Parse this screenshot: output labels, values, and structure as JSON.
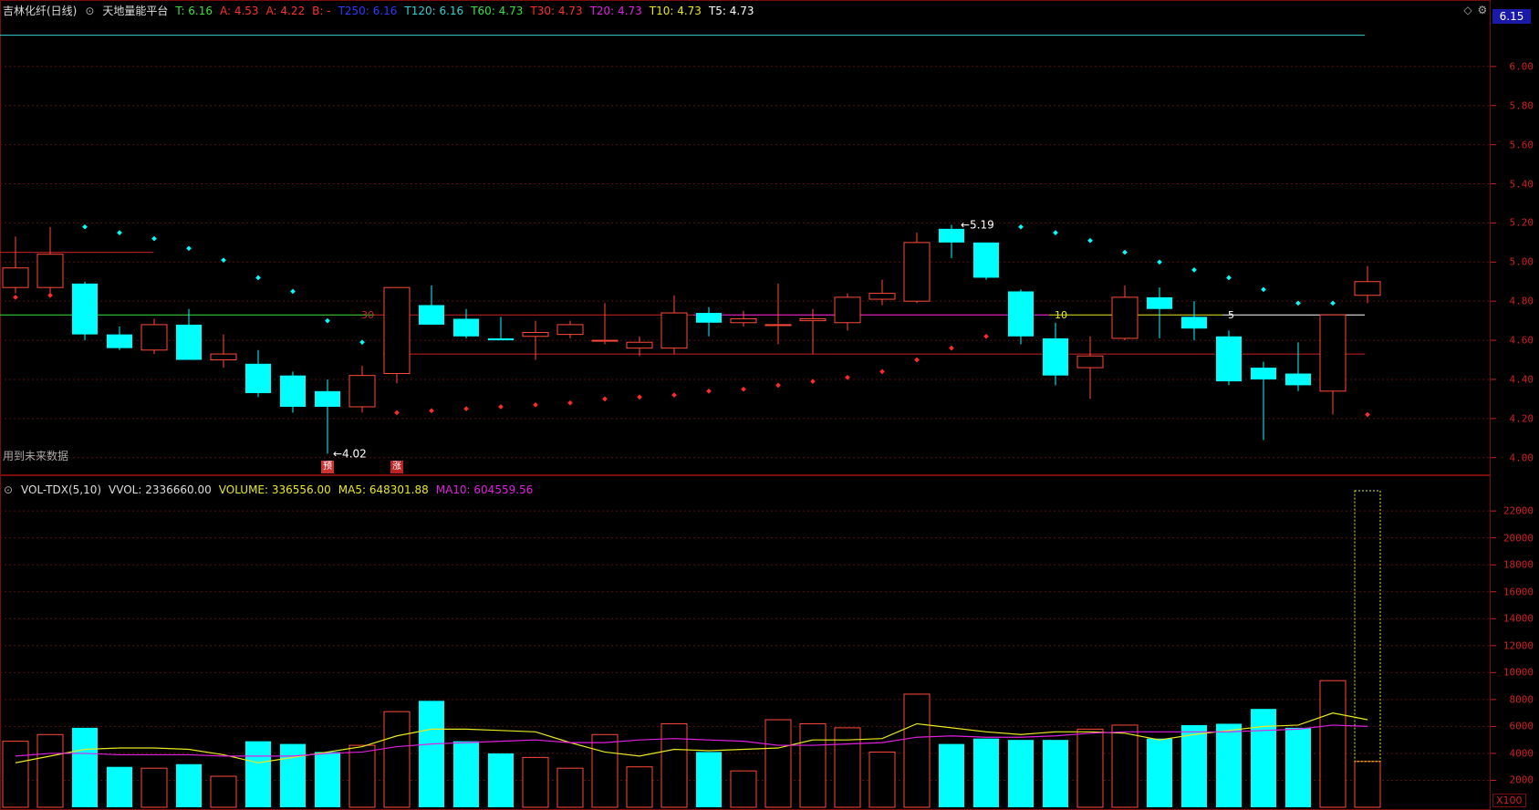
{
  "header": {
    "stock_name": "吉林化纤(日线)",
    "indicator_name": "天地量能平台",
    "items": [
      {
        "label": "T:",
        "value": "6.16",
        "color": "#3be13b"
      },
      {
        "label": "A:",
        "value": "4.53",
        "color": "#ff3030"
      },
      {
        "label": "A:",
        "value": "4.22",
        "color": "#ff3030"
      },
      {
        "label": "B:",
        "value": "-",
        "color": "#ff3030"
      },
      {
        "label": "T250:",
        "value": "6.16",
        "color": "#2a3cff"
      },
      {
        "label": "T120:",
        "value": "6.16",
        "color": "#35d0d0"
      },
      {
        "label": "T60:",
        "value": "4.73",
        "color": "#3be13b"
      },
      {
        "label": "T30:",
        "value": "4.73",
        "color": "#ff3030"
      },
      {
        "label": "T20:",
        "value": "4.73",
        "color": "#e020e0"
      },
      {
        "label": "T10:",
        "value": "4.73",
        "color": "#e8e820"
      },
      {
        "label": "T5:",
        "value": "4.73",
        "color": "#ffffff"
      }
    ]
  },
  "vol_header": {
    "indicator": "VOL-TDX(5,10)",
    "vvol": "VVOL: 2336660.00",
    "volume": "VOLUME: 336556.00",
    "ma5": "MA5: 648301.88",
    "ma10": "MA10: 604559.56"
  },
  "price_tag": "6.15",
  "future_note": "用到未来数据",
  "x100_label": "X100",
  "markers": [
    {
      "text": "预",
      "bg": "#c33",
      "ref_index": 9
    },
    {
      "text": "涨",
      "bg": "#b22",
      "ref_index": 11
    }
  ],
  "annotations": {
    "low_label": "4.02",
    "high_label": "5.19",
    "level_labels": {
      "t30": "30",
      "t10": "10",
      "t5": "5"
    }
  },
  "chart_data": {
    "type": "candlestick",
    "price_ticks": [
      "6.00",
      "5.80",
      "5.60",
      "5.40",
      "5.20",
      "5.00",
      "4.80",
      "4.60",
      "4.40",
      "4.20",
      "4.00"
    ],
    "price_range": [
      3.98,
      6.2
    ],
    "volume_ticks": [
      "22000",
      "20000",
      "18000",
      "16000",
      "14000",
      "12000",
      "10000",
      "8000",
      "6000",
      "4000",
      "2000"
    ],
    "volume_range": [
      0,
      23500
    ],
    "candles": [
      {
        "o": 4.87,
        "h": 5.13,
        "l": 4.84,
        "c": 4.97
      },
      {
        "o": 4.87,
        "h": 5.18,
        "l": 4.83,
        "c": 5.04
      },
      {
        "o": 4.89,
        "h": 4.9,
        "l": 4.6,
        "c": 4.63
      },
      {
        "o": 4.63,
        "h": 4.67,
        "l": 4.55,
        "c": 4.56
      },
      {
        "o": 4.55,
        "h": 4.71,
        "l": 4.53,
        "c": 4.68
      },
      {
        "o": 4.68,
        "h": 4.76,
        "l": 4.5,
        "c": 4.5
      },
      {
        "o": 4.5,
        "h": 4.63,
        "l": 4.46,
        "c": 4.53
      },
      {
        "o": 4.48,
        "h": 4.55,
        "l": 4.31,
        "c": 4.33
      },
      {
        "o": 4.42,
        "h": 4.44,
        "l": 4.23,
        "c": 4.26
      },
      {
        "o": 4.34,
        "h": 4.4,
        "l": 4.02,
        "c": 4.26
      },
      {
        "o": 4.26,
        "h": 4.47,
        "l": 4.23,
        "c": 4.42
      },
      {
        "o": 4.43,
        "h": 4.87,
        "l": 4.38,
        "c": 4.87
      },
      {
        "o": 4.78,
        "h": 4.88,
        "l": 4.68,
        "c": 4.68
      },
      {
        "o": 4.71,
        "h": 4.76,
        "l": 4.61,
        "c": 4.62
      },
      {
        "o": 4.61,
        "h": 4.72,
        "l": 4.6,
        "c": 4.6
      },
      {
        "o": 4.62,
        "h": 4.7,
        "l": 4.5,
        "c": 4.64
      },
      {
        "o": 4.63,
        "h": 4.7,
        "l": 4.61,
        "c": 4.68
      },
      {
        "o": 4.6,
        "h": 4.79,
        "l": 4.58,
        "c": 4.6
      },
      {
        "o": 4.56,
        "h": 4.62,
        "l": 4.52,
        "c": 4.59
      },
      {
        "o": 4.56,
        "h": 4.83,
        "l": 4.53,
        "c": 4.74
      },
      {
        "o": 4.74,
        "h": 4.77,
        "l": 4.62,
        "c": 4.69
      },
      {
        "o": 4.69,
        "h": 4.75,
        "l": 4.67,
        "c": 4.71
      },
      {
        "o": 4.68,
        "h": 4.89,
        "l": 4.58,
        "c": 4.68
      },
      {
        "o": 4.7,
        "h": 4.76,
        "l": 4.53,
        "c": 4.71
      },
      {
        "o": 4.69,
        "h": 4.84,
        "l": 4.65,
        "c": 4.82
      },
      {
        "o": 4.81,
        "h": 4.91,
        "l": 4.78,
        "c": 4.84
      },
      {
        "o": 4.8,
        "h": 5.15,
        "l": 4.79,
        "c": 5.1
      },
      {
        "o": 5.17,
        "h": 5.19,
        "l": 5.02,
        "c": 5.1
      },
      {
        "o": 5.1,
        "h": 5.1,
        "l": 4.91,
        "c": 4.92
      },
      {
        "o": 4.85,
        "h": 4.86,
        "l": 4.58,
        "c": 4.62
      },
      {
        "o": 4.61,
        "h": 4.69,
        "l": 4.37,
        "c": 4.42
      },
      {
        "o": 4.46,
        "h": 4.62,
        "l": 4.3,
        "c": 4.52
      },
      {
        "o": 4.61,
        "h": 4.88,
        "l": 4.6,
        "c": 4.82
      },
      {
        "o": 4.82,
        "h": 4.87,
        "l": 4.61,
        "c": 4.76
      },
      {
        "o": 4.72,
        "h": 4.8,
        "l": 4.6,
        "c": 4.66
      },
      {
        "o": 4.62,
        "h": 4.65,
        "l": 4.37,
        "c": 4.39
      },
      {
        "o": 4.46,
        "h": 4.49,
        "l": 4.09,
        "c": 4.4
      },
      {
        "o": 4.43,
        "h": 4.59,
        "l": 4.34,
        "c": 4.37
      },
      {
        "o": 4.34,
        "h": 4.73,
        "l": 4.22,
        "c": 4.73
      },
      {
        "o": 4.83,
        "h": 4.98,
        "l": 4.79,
        "c": 4.9
      }
    ],
    "sar_points": [
      4.82,
      4.83,
      5.18,
      5.15,
      5.12,
      5.07,
      5.01,
      4.92,
      4.85,
      4.7,
      4.59,
      4.23,
      4.24,
      4.25,
      4.26,
      4.27,
      4.28,
      4.3,
      4.31,
      4.32,
      4.34,
      4.35,
      4.37,
      4.39,
      4.41,
      4.44,
      4.5,
      4.56,
      4.62,
      5.18,
      5.15,
      5.11,
      5.05,
      5.0,
      4.96,
      4.92,
      4.86,
      4.79,
      4.79,
      4.22
    ],
    "sar_colors": [
      "red",
      "red",
      "cyan",
      "cyan",
      "cyan",
      "cyan",
      "cyan",
      "cyan",
      "cyan",
      "cyan",
      "cyan",
      "red",
      "red",
      "red",
      "red",
      "red",
      "red",
      "red",
      "red",
      "red",
      "red",
      "red",
      "red",
      "red",
      "red",
      "red",
      "red",
      "red",
      "red",
      "cyan",
      "cyan",
      "cyan",
      "cyan",
      "cyan",
      "cyan",
      "cyan",
      "cyan",
      "cyan",
      "cyan",
      "red"
    ],
    "volumes": [
      4900,
      5400,
      5900,
      3000,
      2900,
      3200,
      2300,
      4900,
      4700,
      4100,
      4600,
      7100,
      7900,
      4900,
      4000,
      3700,
      2900,
      5400,
      3000,
      6200,
      4100,
      2700,
      6500,
      6200,
      5900,
      4100,
      8400,
      4700,
      5100,
      5000,
      5000,
      5800,
      6100,
      5100,
      6100,
      6200,
      7300,
      5900,
      9400,
      3400
    ],
    "vol_ma5": [
      3300,
      3800,
      4300,
      4400,
      4400,
      4300,
      3900,
      3300,
      3700,
      4100,
      4500,
      5300,
      5800,
      5800,
      5700,
      5600,
      4800,
      4100,
      3800,
      4300,
      4200,
      4300,
      4400,
      5000,
      5000,
      5100,
      6200,
      5900,
      5600,
      5400,
      5600,
      5600,
      5500,
      5000,
      5400,
      5700,
      6000,
      6100,
      7000,
      6500
    ],
    "vol_ma10": [
      3800,
      4000,
      4000,
      3900,
      3900,
      3900,
      3800,
      3800,
      3800,
      4000,
      4100,
      4500,
      4700,
      4800,
      4900,
      5000,
      4800,
      4800,
      5000,
      5100,
      5000,
      4900,
      4600,
      4600,
      4700,
      4800,
      5200,
      5300,
      5200,
      5200,
      5300,
      5500,
      5600,
      5600,
      5600,
      5600,
      5700,
      5800,
      6100,
      6000
    ],
    "level_lines": [
      {
        "name": "T30",
        "value": 4.73,
        "color": "#3be13b"
      },
      {
        "name": "A",
        "value": 4.53,
        "color": "#ff3030"
      },
      {
        "name": "T250",
        "value": 6.16,
        "color": "#35d0d0"
      }
    ],
    "legend": [
      "VOLUME",
      "MA5",
      "MA10"
    ]
  }
}
